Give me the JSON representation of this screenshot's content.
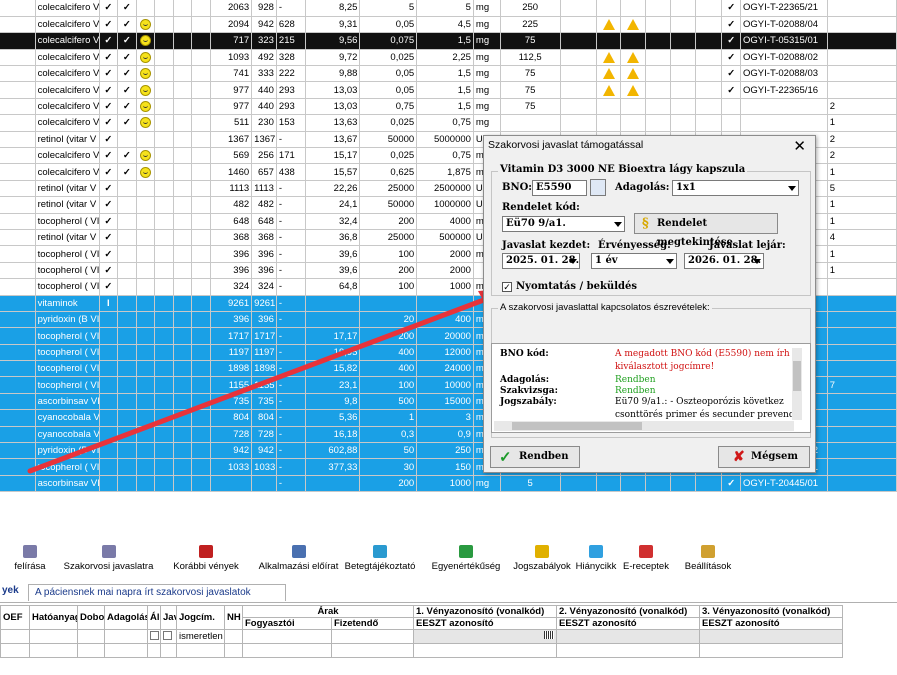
{
  "grid_rows": [
    {
      "style": "white",
      "name": "colecalcifero V",
      "c1": "✓",
      "c2": "✓",
      "smiley": false,
      "n1": "2063",
      "n2": "928",
      "n3": "-",
      "n4": "8,25",
      "n5": "5",
      "n6": "5",
      "unit": "mg",
      "n7": "250",
      "w1": false,
      "w2": false,
      "check": "✓",
      "ogyi": "OGYI-T-22365/21"
    },
    {
      "style": "white",
      "name": "colecalcifero V",
      "c1": "✓",
      "c2": "✓",
      "smiley": true,
      "n1": "2094",
      "n2": "942",
      "n3": "628",
      "n4": "9,31",
      "n5": "0,05",
      "n6": "4,5",
      "unit": "mg",
      "n7": "225",
      "w1": true,
      "w2": true,
      "check": "✓",
      "ogyi": "OGYI-T-02088/04"
    },
    {
      "style": "sel",
      "name": "colecalcifero V",
      "c1": "✓",
      "c2": "✓",
      "smiley": true,
      "n1": "717",
      "n2": "323",
      "n3": "215",
      "n4": "9,56",
      "n5": "0,075",
      "n6": "1,5",
      "unit": "mg",
      "n7": "75",
      "w1": false,
      "w2": false,
      "check": "✓",
      "ogyi": "OGYI-T-05315/01"
    },
    {
      "style": "white",
      "name": "colecalcifero V",
      "c1": "✓",
      "c2": "✓",
      "smiley": true,
      "n1": "1093",
      "n2": "492",
      "n3": "328",
      "n4": "9,72",
      "n5": "0,025",
      "n6": "2,25",
      "unit": "mg",
      "n7": "112,5",
      "w1": true,
      "w2": true,
      "check": "✓",
      "ogyi": "OGYI-T-02088/02"
    },
    {
      "style": "white",
      "name": "colecalcifero V",
      "c1": "✓",
      "c2": "✓",
      "smiley": true,
      "n1": "741",
      "n2": "333",
      "n3": "222",
      "n4": "9,88",
      "n5": "0,05",
      "n6": "1,5",
      "unit": "mg",
      "n7": "75",
      "w1": true,
      "w2": true,
      "check": "✓",
      "ogyi": "OGYI-T-02088/03"
    },
    {
      "style": "white",
      "name": "colecalcifero V",
      "c1": "✓",
      "c2": "✓",
      "smiley": true,
      "n1": "977",
      "n2": "440",
      "n3": "293",
      "n4": "13,03",
      "n5": "0,05",
      "n6": "1,5",
      "unit": "mg",
      "n7": "75",
      "w1": true,
      "w2": true,
      "check": "✓",
      "ogyi": "OGYI-T-22365/16"
    },
    {
      "style": "white",
      "name": "colecalcifero V",
      "c1": "✓",
      "c2": "✓",
      "smiley": true,
      "n1": "977",
      "n2": "440",
      "n3": "293",
      "n4": "13,03",
      "n5": "0,75",
      "n6": "1,5",
      "unit": "mg",
      "n7": "75",
      "w1": false,
      "w2": false,
      "check": "",
      "ogyi": ""
    },
    {
      "style": "white",
      "name": "colecalcifero V",
      "c1": "✓",
      "c2": "✓",
      "smiley": true,
      "n1": "511",
      "n2": "230",
      "n3": "153",
      "n4": "13,63",
      "n5": "0,025",
      "n6": "0,75",
      "unit": "mg",
      "n7": "",
      "w1": false,
      "w2": false,
      "check": "",
      "ogyi": ""
    },
    {
      "style": "white",
      "name": "retinol (vitar V",
      "c1": "✓",
      "c2": "",
      "smiley": false,
      "n1": "1367",
      "n2": "1367",
      "n3": "-",
      "n4": "13,67",
      "n5": "50000",
      "n6": "5000000",
      "unit": "U",
      "n7": "",
      "w1": false,
      "w2": false,
      "check": "",
      "ogyi": ""
    },
    {
      "style": "white",
      "name": "colecalcifero V",
      "c1": "✓",
      "c2": "✓",
      "smiley": true,
      "n1": "569",
      "n2": "256",
      "n3": "171",
      "n4": "15,17",
      "n5": "0,025",
      "n6": "0,75",
      "unit": "mg",
      "n7": "",
      "w1": false,
      "w2": false,
      "check": "",
      "ogyi": ""
    },
    {
      "style": "white",
      "name": "colecalcifero V",
      "c1": "✓",
      "c2": "✓",
      "smiley": true,
      "n1": "1460",
      "n2": "657",
      "n3": "438",
      "n4": "15,57",
      "n5": "0,625",
      "n6": "1,875",
      "unit": "mg",
      "n7": "",
      "w1": false,
      "w2": false,
      "check": "",
      "ogyi": ""
    },
    {
      "style": "white",
      "name": "retinol (vitar V",
      "c1": "✓",
      "c2": "",
      "smiley": false,
      "n1": "1113",
      "n2": "1113",
      "n3": "-",
      "n4": "22,26",
      "n5": "25000",
      "n6": "2500000",
      "unit": "U",
      "n7": "",
      "w1": false,
      "w2": false,
      "check": "",
      "ogyi": ""
    },
    {
      "style": "white",
      "name": "retinol (vitar V",
      "c1": "✓",
      "c2": "",
      "smiley": false,
      "n1": "482",
      "n2": "482",
      "n3": "-",
      "n4": "24,1",
      "n5": "50000",
      "n6": "1000000",
      "unit": "U",
      "n7": "",
      "w1": false,
      "w2": false,
      "check": "",
      "ogyi": ""
    },
    {
      "style": "white",
      "name": "tocopherol ( VI",
      "c1": "✓",
      "c2": "",
      "smiley": false,
      "n1": "648",
      "n2": "648",
      "n3": "-",
      "n4": "32,4",
      "n5": "200",
      "n6": "4000",
      "unit": "mg",
      "n7": "",
      "w1": false,
      "w2": false,
      "check": "",
      "ogyi": ""
    },
    {
      "style": "white",
      "name": "retinol (vitar V",
      "c1": "✓",
      "c2": "",
      "smiley": false,
      "n1": "368",
      "n2": "368",
      "n3": "-",
      "n4": "36,8",
      "n5": "25000",
      "n6": "500000",
      "unit": "U",
      "n7": "",
      "w1": false,
      "w2": false,
      "check": "",
      "ogyi": ""
    },
    {
      "style": "white",
      "name": "tocopherol ( VI",
      "c1": "✓",
      "c2": "",
      "smiley": false,
      "n1": "396",
      "n2": "396",
      "n3": "-",
      "n4": "39,6",
      "n5": "100",
      "n6": "2000",
      "unit": "mg",
      "n7": "",
      "w1": false,
      "w2": false,
      "check": "",
      "ogyi": ""
    },
    {
      "style": "white",
      "name": "tocopherol ( VI",
      "c1": "✓",
      "c2": "",
      "smiley": false,
      "n1": "396",
      "n2": "396",
      "n3": "-",
      "n4": "39,6",
      "n5": "200",
      "n6": "2000",
      "unit": "",
      "n7": "",
      "w1": false,
      "w2": false,
      "check": "",
      "ogyi": ""
    },
    {
      "style": "white",
      "name": "tocopherol ( VI",
      "c1": "✓",
      "c2": "",
      "smiley": false,
      "n1": "324",
      "n2": "324",
      "n3": "-",
      "n4": "64,8",
      "n5": "100",
      "n6": "1000",
      "unit": "mg",
      "n7": "",
      "w1": false,
      "w2": false,
      "check": "",
      "ogyi": ""
    },
    {
      "style": "blue",
      "name": "vitaminok",
      "c1": "I",
      "c2": "",
      "smiley": false,
      "n1": "9261",
      "n2": "9261",
      "n3": "-",
      "n4": "",
      "n5": "",
      "n6": "",
      "unit": "",
      "n7": "",
      "w1": false,
      "w2": false,
      "check": "",
      "ogyi": ""
    },
    {
      "style": "blue",
      "name": "pyridoxin (B VI",
      "c1": "",
      "c2": "",
      "smiley": false,
      "n1": "396",
      "n2": "396",
      "n3": "-",
      "n4": "",
      "n5": "20",
      "n6": "400",
      "unit": "mg",
      "n7": "",
      "w1": false,
      "w2": false,
      "check": "",
      "ogyi": ""
    },
    {
      "style": "blue",
      "name": "tocopherol ( VI",
      "c1": "",
      "c2": "",
      "smiley": false,
      "n1": "1717",
      "n2": "1717",
      "n3": "-",
      "n4": "17,17",
      "n5": "200",
      "n6": "20000",
      "unit": "mg",
      "n7": "",
      "w1": false,
      "w2": false,
      "check": "",
      "ogyi": ""
    },
    {
      "style": "blue",
      "name": "tocopherol ( VI",
      "c1": "",
      "c2": "",
      "smiley": false,
      "n1": "1197",
      "n2": "1197",
      "n3": "-",
      "n4": "19,95",
      "n5": "400",
      "n6": "12000",
      "unit": "mg",
      "n7": "",
      "w1": false,
      "w2": false,
      "check": "",
      "ogyi": ""
    },
    {
      "style": "blue",
      "name": "tocopherol ( VI",
      "c1": "",
      "c2": "",
      "smiley": false,
      "n1": "1898",
      "n2": "1898",
      "n3": "-",
      "n4": "15,82",
      "n5": "400",
      "n6": "24000",
      "unit": "mg",
      "n7": "",
      "w1": false,
      "w2": false,
      "check": "",
      "ogyi": ""
    },
    {
      "style": "blue",
      "name": "tocopherol ( VI",
      "c1": "",
      "c2": "",
      "smiley": false,
      "n1": "1155",
      "n2": "1155",
      "n3": "-",
      "n4": "23,1",
      "n5": "100",
      "n6": "10000",
      "unit": "mg",
      "n7": "",
      "w1": false,
      "w2": false,
      "check": "",
      "ogyi": ""
    },
    {
      "style": "blue",
      "name": "ascorbinsav VI",
      "c1": "",
      "c2": "",
      "smiley": false,
      "n1": "735",
      "n2": "735",
      "n3": "-",
      "n4": "9,8",
      "n5": "500",
      "n6": "15000",
      "unit": "mg",
      "n7": "",
      "w1": false,
      "w2": false,
      "check": "",
      "ogyi": ""
    },
    {
      "style": "blue",
      "name": "cyanocobala V",
      "c1": "",
      "c2": "",
      "smiley": false,
      "n1": "804",
      "n2": "804",
      "n3": "-",
      "n4": "5,36",
      "n5": "1",
      "n6": "3",
      "unit": "mg",
      "n7": "",
      "w1": false,
      "w2": false,
      "check": "",
      "ogyi": ""
    },
    {
      "style": "blue",
      "name": "cyanocobala V",
      "c1": "",
      "c2": "",
      "smiley": false,
      "n1": "728",
      "n2": "728",
      "n3": "-",
      "n4": "16,18",
      "n5": "0,3",
      "n6": "0,9",
      "unit": "mg",
      "n7": "",
      "w1": false,
      "w2": false,
      "check": "",
      "ogyi": ""
    },
    {
      "style": "blue",
      "name": "pyridoxin (B VI",
      "c1": "",
      "c2": "",
      "smiley": false,
      "n1": "942",
      "n2": "942",
      "n3": "-",
      "n4": "602,88",
      "n5": "50",
      "n6": "250",
      "unit": "mg",
      "n7": "1,56",
      "w1": false,
      "w2": false,
      "check": "✓",
      "ogyi": "OGYI-T-02766/02"
    },
    {
      "style": "blue",
      "name": "tocopherol ( VI",
      "c1": "",
      "c2": "",
      "smiley": false,
      "n1": "1033",
      "n2": "1033",
      "n3": "-",
      "n4": "377,33",
      "n5": "30",
      "n6": "150",
      "unit": "mg",
      "n7": "0,75",
      "w1": false,
      "w2": false,
      "check": "✓",
      "ogyi": "OGYI-T-02756/01"
    },
    {
      "style": "blue",
      "name": "ascorbinsav VI",
      "c1": "",
      "c2": "",
      "smiley": false,
      "n1": "",
      "n2": "",
      "n3": "-",
      "n4": "",
      "n5": "200",
      "n6": "1000",
      "unit": "mg",
      "n7": "5",
      "w1": false,
      "w2": false,
      "check": "✓",
      "ogyi": "OGYI-T-20445/01"
    }
  ],
  "right_edge_digits": [
    "2",
    "1",
    "2",
    "2",
    "1",
    "5",
    "1",
    "1",
    "4",
    "1",
    "1",
    "",
    "",
    "",
    "",
    "",
    "",
    "7",
    "",
    "",
    "",
    "",
    ""
  ],
  "toolbar": {
    "items": [
      {
        "label": "felírása",
        "icon": "prescription-icon"
      },
      {
        "label": "Szakorvosi javaslatra",
        "icon": "specialist-icon"
      },
      {
        "label": "Korábbi vények",
        "icon": "history-icon"
      },
      {
        "label": "Alkalmazási előírat",
        "icon": "document-icon"
      },
      {
        "label": "Betegtájékoztató",
        "icon": "leaflet-icon"
      },
      {
        "label": "Egyenértékűség",
        "icon": "equivalence-icon"
      },
      {
        "label": "Jogszabályok",
        "icon": "law-icon"
      },
      {
        "label": "Hiánycikk",
        "icon": "question-icon"
      },
      {
        "label": "E-receptek",
        "icon": "erecipe-icon"
      },
      {
        "label": "Beállítások",
        "icon": "settings-icon"
      }
    ]
  },
  "tabs": {
    "first": "yek",
    "second": "A páciensnek mai napra írt szakorvosi javaslatok"
  },
  "bottom_table": {
    "headers": [
      "OEF",
      "Hatóanyag",
      "Dobo",
      "Adagolás",
      "Álla",
      "Jav",
      "Jogcím.",
      "NH"
    ],
    "arak_label": "Árak",
    "fogyaszto": "Fogyasztói",
    "fizetendo": "Fizetendő",
    "v1": "1. Vényazonosító (vonalkód)",
    "v2": "2. Vényazonosító (vonalkód)",
    "v3": "3. Vényazonosító (vonalkód)",
    "eeszt": "EESZT azonosító",
    "row_value": "ismeretlen"
  },
  "dialog": {
    "title": "Szakorvosi javaslat támogatással",
    "product": "Vitamin D3 3000 NE Bioextra lágy kapszula",
    "bno_label": "BNO:",
    "bno_value": "E5590",
    "adagolas_label": "Adagolás:",
    "adagolas_value": "1x1",
    "rendelet_label": "Rendelet kód:",
    "rendelet_value": "Eü70 9/a1.",
    "rendelet_btn": "Rendelet megtekintése",
    "javaslat_kezdet_label": "Javaslat kezdet:",
    "ervenyesseg_label": "Érvényesség:",
    "javaslat_lejar_label": "Javaslat lejár:",
    "javaslat_kezdet_value": "2025. 01. 28.",
    "ervenyesseg_value": "1 év",
    "javaslat_lejar_value": "2026. 01. 28.",
    "nyomtatas_label": "Nyomtatás / beküldés",
    "obs_legend": "A szakorvosi javaslattal kapcsolatos észrevételek:",
    "obs": [
      {
        "label": "BNO kód:",
        "value": "A megadott BNO kód (E5590) nem írh",
        "color": "#d01010"
      },
      {
        "label": "",
        "value": "kiválasztott jogcímre!",
        "color": "#d01010"
      },
      {
        "label": "Adagolás:",
        "value": "Rendben",
        "color": "#20a020"
      },
      {
        "label": "Szakvizsga:",
        "value": "Rendben",
        "color": "#20a020"
      },
      {
        "label": "Jogszabály:",
        "value": "Eü70 9/a1.: - Oszteoporózis következ",
        "color": "#000000"
      },
      {
        "label": "",
        "value": "csonttörés primer és secunder prevenció",
        "color": "#000000"
      },
      {
        "label": "",
        "value": "alkalmazható a kalcium- és D-vitamin",
        "color": "#000000"
      }
    ],
    "ok_label": "Rendben",
    "cancel_label": "Mégsem"
  },
  "colors": {
    "selection_blue": "#1aa0e6",
    "arrow_red": "#e8333a",
    "ok_green": "#1c9a2a",
    "cancel_red": "#d01818"
  }
}
